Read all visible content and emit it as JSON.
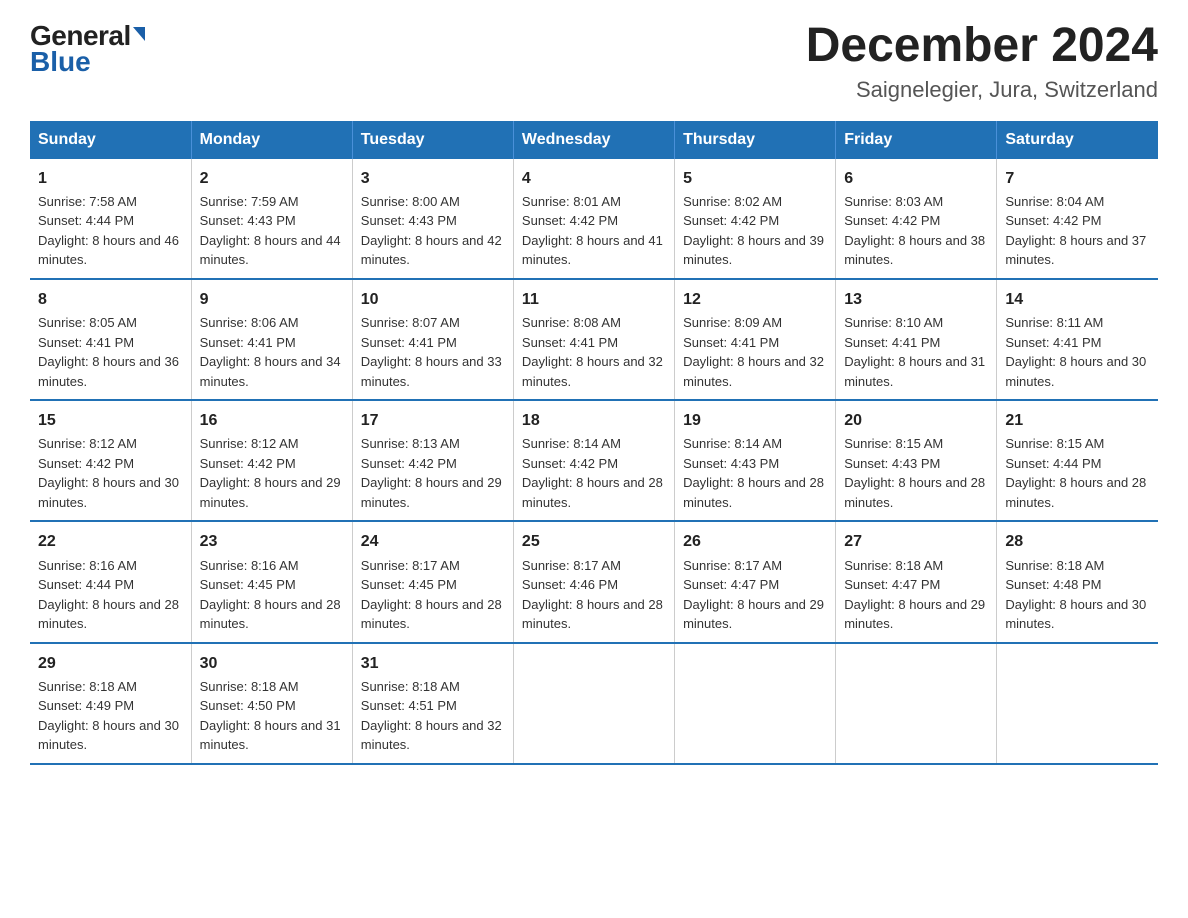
{
  "header": {
    "logo_general": "General",
    "logo_blue": "Blue",
    "month_title": "December 2024",
    "location": "Saignelegier, Jura, Switzerland"
  },
  "weekdays": [
    "Sunday",
    "Monday",
    "Tuesday",
    "Wednesday",
    "Thursday",
    "Friday",
    "Saturday"
  ],
  "weeks": [
    [
      {
        "day": "1",
        "sunrise": "Sunrise: 7:58 AM",
        "sunset": "Sunset: 4:44 PM",
        "daylight": "Daylight: 8 hours and 46 minutes."
      },
      {
        "day": "2",
        "sunrise": "Sunrise: 7:59 AM",
        "sunset": "Sunset: 4:43 PM",
        "daylight": "Daylight: 8 hours and 44 minutes."
      },
      {
        "day": "3",
        "sunrise": "Sunrise: 8:00 AM",
        "sunset": "Sunset: 4:43 PM",
        "daylight": "Daylight: 8 hours and 42 minutes."
      },
      {
        "day": "4",
        "sunrise": "Sunrise: 8:01 AM",
        "sunset": "Sunset: 4:42 PM",
        "daylight": "Daylight: 8 hours and 41 minutes."
      },
      {
        "day": "5",
        "sunrise": "Sunrise: 8:02 AM",
        "sunset": "Sunset: 4:42 PM",
        "daylight": "Daylight: 8 hours and 39 minutes."
      },
      {
        "day": "6",
        "sunrise": "Sunrise: 8:03 AM",
        "sunset": "Sunset: 4:42 PM",
        "daylight": "Daylight: 8 hours and 38 minutes."
      },
      {
        "day": "7",
        "sunrise": "Sunrise: 8:04 AM",
        "sunset": "Sunset: 4:42 PM",
        "daylight": "Daylight: 8 hours and 37 minutes."
      }
    ],
    [
      {
        "day": "8",
        "sunrise": "Sunrise: 8:05 AM",
        "sunset": "Sunset: 4:41 PM",
        "daylight": "Daylight: 8 hours and 36 minutes."
      },
      {
        "day": "9",
        "sunrise": "Sunrise: 8:06 AM",
        "sunset": "Sunset: 4:41 PM",
        "daylight": "Daylight: 8 hours and 34 minutes."
      },
      {
        "day": "10",
        "sunrise": "Sunrise: 8:07 AM",
        "sunset": "Sunset: 4:41 PM",
        "daylight": "Daylight: 8 hours and 33 minutes."
      },
      {
        "day": "11",
        "sunrise": "Sunrise: 8:08 AM",
        "sunset": "Sunset: 4:41 PM",
        "daylight": "Daylight: 8 hours and 32 minutes."
      },
      {
        "day": "12",
        "sunrise": "Sunrise: 8:09 AM",
        "sunset": "Sunset: 4:41 PM",
        "daylight": "Daylight: 8 hours and 32 minutes."
      },
      {
        "day": "13",
        "sunrise": "Sunrise: 8:10 AM",
        "sunset": "Sunset: 4:41 PM",
        "daylight": "Daylight: 8 hours and 31 minutes."
      },
      {
        "day": "14",
        "sunrise": "Sunrise: 8:11 AM",
        "sunset": "Sunset: 4:41 PM",
        "daylight": "Daylight: 8 hours and 30 minutes."
      }
    ],
    [
      {
        "day": "15",
        "sunrise": "Sunrise: 8:12 AM",
        "sunset": "Sunset: 4:42 PM",
        "daylight": "Daylight: 8 hours and 30 minutes."
      },
      {
        "day": "16",
        "sunrise": "Sunrise: 8:12 AM",
        "sunset": "Sunset: 4:42 PM",
        "daylight": "Daylight: 8 hours and 29 minutes."
      },
      {
        "day": "17",
        "sunrise": "Sunrise: 8:13 AM",
        "sunset": "Sunset: 4:42 PM",
        "daylight": "Daylight: 8 hours and 29 minutes."
      },
      {
        "day": "18",
        "sunrise": "Sunrise: 8:14 AM",
        "sunset": "Sunset: 4:42 PM",
        "daylight": "Daylight: 8 hours and 28 minutes."
      },
      {
        "day": "19",
        "sunrise": "Sunrise: 8:14 AM",
        "sunset": "Sunset: 4:43 PM",
        "daylight": "Daylight: 8 hours and 28 minutes."
      },
      {
        "day": "20",
        "sunrise": "Sunrise: 8:15 AM",
        "sunset": "Sunset: 4:43 PM",
        "daylight": "Daylight: 8 hours and 28 minutes."
      },
      {
        "day": "21",
        "sunrise": "Sunrise: 8:15 AM",
        "sunset": "Sunset: 4:44 PM",
        "daylight": "Daylight: 8 hours and 28 minutes."
      }
    ],
    [
      {
        "day": "22",
        "sunrise": "Sunrise: 8:16 AM",
        "sunset": "Sunset: 4:44 PM",
        "daylight": "Daylight: 8 hours and 28 minutes."
      },
      {
        "day": "23",
        "sunrise": "Sunrise: 8:16 AM",
        "sunset": "Sunset: 4:45 PM",
        "daylight": "Daylight: 8 hours and 28 minutes."
      },
      {
        "day": "24",
        "sunrise": "Sunrise: 8:17 AM",
        "sunset": "Sunset: 4:45 PM",
        "daylight": "Daylight: 8 hours and 28 minutes."
      },
      {
        "day": "25",
        "sunrise": "Sunrise: 8:17 AM",
        "sunset": "Sunset: 4:46 PM",
        "daylight": "Daylight: 8 hours and 28 minutes."
      },
      {
        "day": "26",
        "sunrise": "Sunrise: 8:17 AM",
        "sunset": "Sunset: 4:47 PM",
        "daylight": "Daylight: 8 hours and 29 minutes."
      },
      {
        "day": "27",
        "sunrise": "Sunrise: 8:18 AM",
        "sunset": "Sunset: 4:47 PM",
        "daylight": "Daylight: 8 hours and 29 minutes."
      },
      {
        "day": "28",
        "sunrise": "Sunrise: 8:18 AM",
        "sunset": "Sunset: 4:48 PM",
        "daylight": "Daylight: 8 hours and 30 minutes."
      }
    ],
    [
      {
        "day": "29",
        "sunrise": "Sunrise: 8:18 AM",
        "sunset": "Sunset: 4:49 PM",
        "daylight": "Daylight: 8 hours and 30 minutes."
      },
      {
        "day": "30",
        "sunrise": "Sunrise: 8:18 AM",
        "sunset": "Sunset: 4:50 PM",
        "daylight": "Daylight: 8 hours and 31 minutes."
      },
      {
        "day": "31",
        "sunrise": "Sunrise: 8:18 AM",
        "sunset": "Sunset: 4:51 PM",
        "daylight": "Daylight: 8 hours and 32 minutes."
      },
      null,
      null,
      null,
      null
    ]
  ]
}
